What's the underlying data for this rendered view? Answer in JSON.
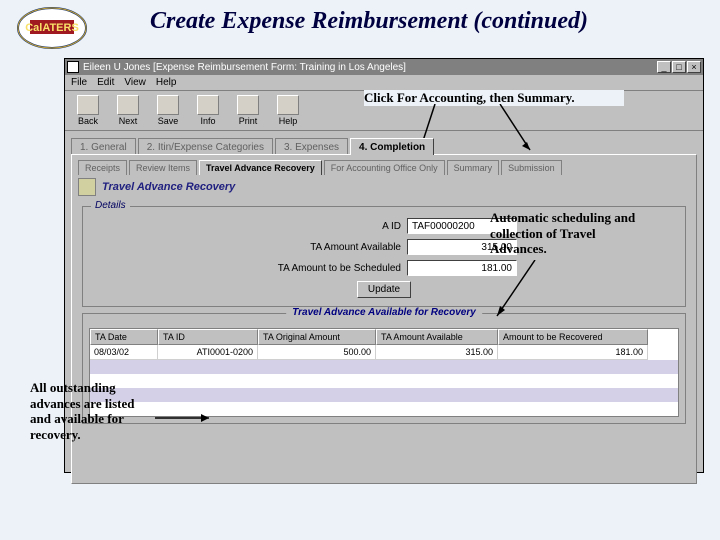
{
  "page": {
    "heading": "Create Expense Reimbursement (continued)"
  },
  "window": {
    "title": "Eileen U Jones [Expense Reimbursement Form: Training in Los Angeles]",
    "menu": {
      "file": "File",
      "edit": "Edit",
      "view": "View",
      "help": "Help"
    },
    "toolbar": {
      "back": "Back",
      "next": "Next",
      "save": "Save",
      "info": "Info",
      "print": "Print",
      "help": "Help"
    },
    "main_tabs": [
      "1. General",
      "2. Itin/Expense Categories",
      "3. Expenses",
      "4. Completion"
    ],
    "main_tab_active": 3,
    "sub_tabs": [
      "Receipts",
      "Review Items",
      "Travel Advance Recovery",
      "For Accounting Office Only",
      "Summary",
      "Submission"
    ],
    "sub_tab_active": 2,
    "panel_title": "Travel Advance Recovery",
    "details_legend": "Details",
    "fields": {
      "a_id_label": "A ID",
      "a_id_value": "TAF00000200",
      "avail_label": "TA Amount Available",
      "avail_value": "315.00",
      "sched_label": "TA Amount to be Scheduled",
      "sched_value": "181.00",
      "update_label": "Update"
    },
    "grid": {
      "legend": "Travel Advance Available for Recovery",
      "headers": [
        "TA Date",
        "TA ID",
        "TA Original Amount",
        "TA Amount Available",
        "Amount to be Recovered"
      ],
      "row": [
        "08/03/02",
        "ATI0001-0200",
        "500.00",
        "315.00",
        "181.00"
      ]
    }
  },
  "callouts": {
    "top": "Click For Accounting, then Summary.",
    "right": "Automatic scheduling and collection of Travel Advances.",
    "left": "All outstanding advances are listed and available for recovery."
  }
}
